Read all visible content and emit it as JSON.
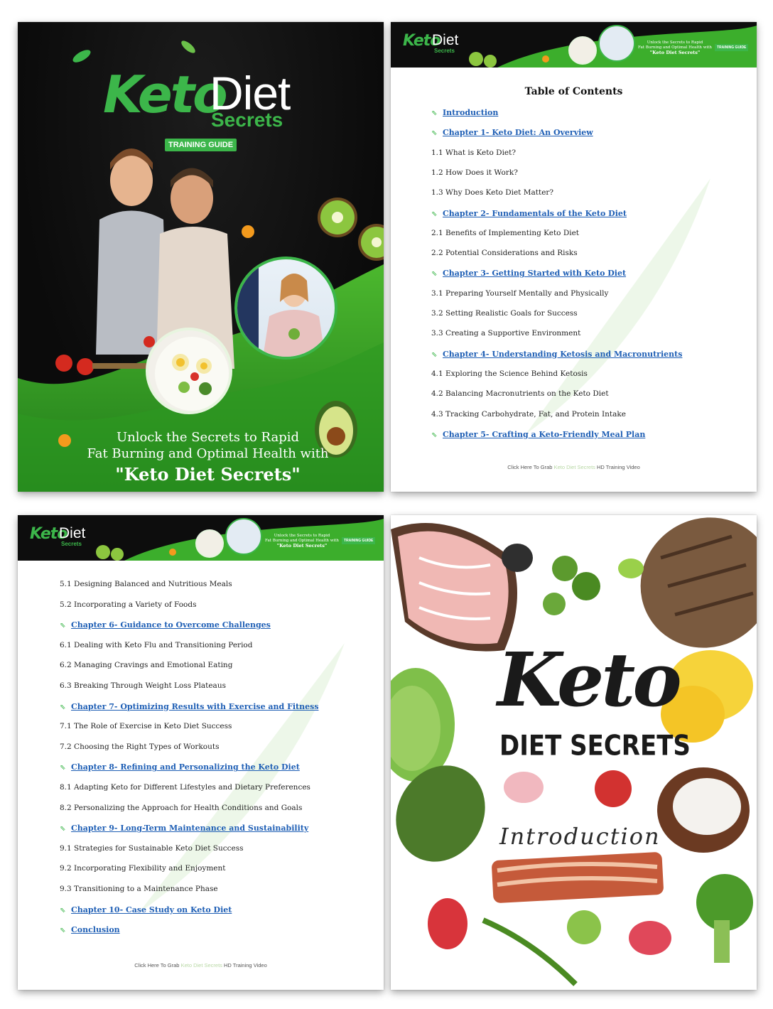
{
  "cover": {
    "logo_keto": "Keto",
    "logo_diet": "Diet",
    "logo_secrets": "Secrets",
    "badge": "TRAINING GUIDE",
    "tagline_1": "Unlock the Secrets to Rapid",
    "tagline_2": "Fat Burning and Optimal Health with",
    "tagline_3": "\"Keto Diet Secrets\""
  },
  "header": {
    "logo_keto": "Keto",
    "logo_diet": "Diet",
    "logo_secrets": "Secrets",
    "line_1": "Unlock the Secrets to Rapid",
    "line_2": "Fat Burning and Optimal Health with",
    "line_3": "\"Keto Diet Secrets\"",
    "badge": "TRAINING GUIDE"
  },
  "toc": {
    "title": "Table of Contents",
    "page1": [
      {
        "text": "Introduction",
        "chapter": true
      },
      {
        "text": "Chapter 1- Keto Diet: An Overview",
        "chapter": true
      },
      {
        "text": "1.1 What is Keto Diet?",
        "chapter": false
      },
      {
        "text": "1.2 How Does it Work?",
        "chapter": false
      },
      {
        "text": "1.3 Why Does Keto Diet Matter?",
        "chapter": false
      },
      {
        "text": "Chapter 2- Fundamentals of the Keto Diet",
        "chapter": true
      },
      {
        "text": "2.1 Benefits of Implementing Keto Diet",
        "chapter": false
      },
      {
        "text": "2.2 Potential Considerations and Risks",
        "chapter": false
      },
      {
        "text": "Chapter 3- Getting Started with Keto Diet",
        "chapter": true
      },
      {
        "text": "3.1 Preparing Yourself Mentally and Physically",
        "chapter": false
      },
      {
        "text": "3.2 Setting Realistic Goals for Success",
        "chapter": false
      },
      {
        "text": "3.3 Creating a Supportive Environment",
        "chapter": false
      },
      {
        "text": "Chapter 4- Understanding Ketosis and Macronutrients",
        "chapter": true
      },
      {
        "text": "4.1 Exploring the Science Behind Ketosis",
        "chapter": false
      },
      {
        "text": "4.2 Balancing Macronutrients on the Keto Diet",
        "chapter": false
      },
      {
        "text": "4.3 Tracking Carbohydrate, Fat, and Protein Intake",
        "chapter": false
      },
      {
        "text": "Chapter 5- Crafting a Keto-Friendly Meal Plan",
        "chapter": true
      }
    ],
    "page2": [
      {
        "text": "5.1 Designing Balanced and Nutritious Meals",
        "chapter": false
      },
      {
        "text": "5.2 Incorporating a Variety of Foods",
        "chapter": false
      },
      {
        "text": "Chapter 6- Guidance to Overcome Challenges",
        "chapter": true
      },
      {
        "text": "6.1 Dealing with Keto Flu and Transitioning Period",
        "chapter": false
      },
      {
        "text": "6.2 Managing Cravings and Emotional Eating",
        "chapter": false
      },
      {
        "text": "6.3 Breaking Through Weight Loss Plateaus",
        "chapter": false
      },
      {
        "text": "Chapter 7- Optimizing Results with Exercise and Fitness",
        "chapter": true
      },
      {
        "text": "7.1 The Role of Exercise in Keto Diet Success",
        "chapter": false
      },
      {
        "text": "7.2 Choosing the Right Types of Workouts",
        "chapter": false
      },
      {
        "text": "Chapter 8- Refining and Personalizing the Keto Diet",
        "chapter": true
      },
      {
        "text": "8.1 Adapting Keto for Different Lifestyles and Dietary Preferences",
        "chapter": false
      },
      {
        "text": "8.2 Personalizing the Approach for Health Conditions and Goals",
        "chapter": false
      },
      {
        "text": "Chapter 9- Long-Term Maintenance and Sustainability",
        "chapter": true
      },
      {
        "text": "9.1 Strategies for Sustainable Keto Diet Success",
        "chapter": false
      },
      {
        "text": "9.2 Incorporating Flexibility and Enjoyment",
        "chapter": false
      },
      {
        "text": "9.3 Transitioning to a Maintenance Phase",
        "chapter": false
      },
      {
        "text": "Chapter 10- Case Study on Keto Diet",
        "chapter": true
      },
      {
        "text": "Conclusion",
        "chapter": true
      }
    ],
    "footer_pre": "Click Here To Grab ",
    "footer_link": "Keto Diet Secrets",
    "footer_post": " HD Training Video"
  },
  "intro": {
    "keto": "Keto",
    "diet_secrets": "DIET SECRETS",
    "heading": "Introduction"
  },
  "colors": {
    "brand_green": "#3cb64a",
    "link_blue": "#1f5fb5"
  }
}
